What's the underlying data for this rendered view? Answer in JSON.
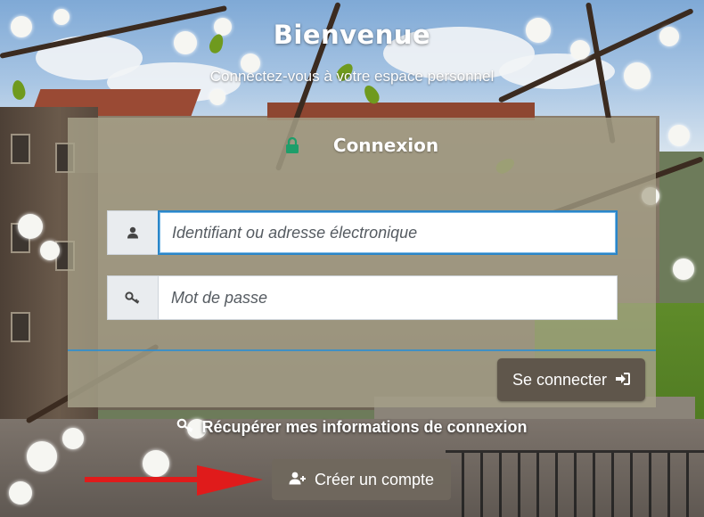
{
  "welcome": {
    "title": "Bienvenue",
    "subtitle": "Connectez-vous à votre espace personnel"
  },
  "login": {
    "title": "Connexion",
    "lock_icon": "lock-icon",
    "username_placeholder": "Identifiant ou adresse électronique",
    "username_icon": "user-icon",
    "password_placeholder": "Mot de passe",
    "password_icon": "key-icon",
    "submit_label": "Se connecter",
    "submit_icon": "sign-in-icon"
  },
  "links": {
    "recover_label": "Récupérer mes informations de connexion",
    "recover_icon": "key-icon",
    "create_account_label": "Créer un compte",
    "create_account_icon": "user-plus-icon"
  },
  "annotation": {
    "arrow_color": "#e01b1b"
  },
  "colors": {
    "lock_green": "#1e9e6a",
    "focus_blue": "#2a86c9",
    "button_dark": "#5f564b"
  }
}
